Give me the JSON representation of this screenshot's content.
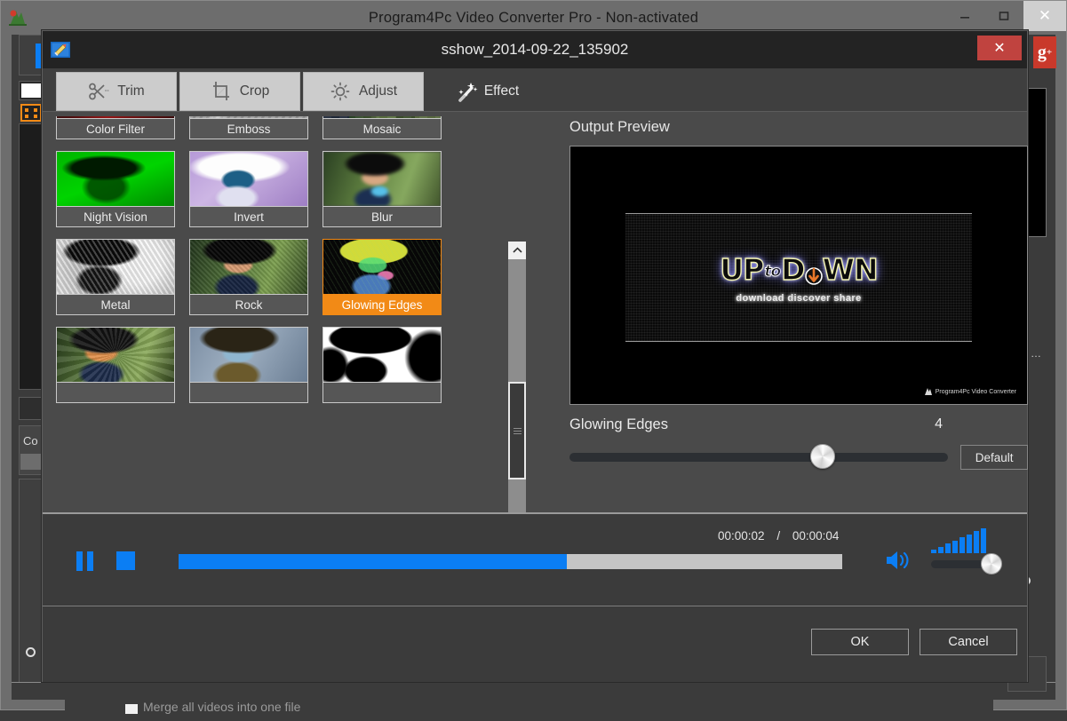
{
  "app_window": {
    "title": "Program4Pc Video Converter Pro - Non-activated",
    "icon": "app-logo-icon",
    "controls": {
      "minimize": "–",
      "maximize": "□",
      "close": "✕"
    },
    "background": {
      "merge_checkbox_label": "Merge all videos into one file",
      "convert_label": "Co",
      "gplus_label": "g",
      "gplus_sup": "+"
    }
  },
  "dialog": {
    "title": "sshow_2014-09-22_135902",
    "icon": "edit-video-icon",
    "close_label": "✕",
    "tabs": [
      {
        "label": "Trim",
        "icon": "scissors-icon",
        "active": false
      },
      {
        "label": "Crop",
        "icon": "crop-icon",
        "active": false
      },
      {
        "label": "Adjust",
        "icon": "brightness-icon",
        "active": false
      },
      {
        "label": "Effect",
        "icon": "magic-wand-icon",
        "active": true
      }
    ],
    "effects": [
      {
        "label": "Color Filter",
        "selected": false,
        "style": "colorfilter"
      },
      {
        "label": "Emboss",
        "selected": false,
        "style": "emboss"
      },
      {
        "label": "Mosaic",
        "selected": false,
        "style": "mosaic"
      },
      {
        "label": "Night Vision",
        "selected": false,
        "style": "nightvision"
      },
      {
        "label": "Invert",
        "selected": false,
        "style": "invert"
      },
      {
        "label": "Blur",
        "selected": false,
        "style": "blur"
      },
      {
        "label": "Metal",
        "selected": false,
        "style": "metal"
      },
      {
        "label": "Rock",
        "selected": false,
        "style": "rock"
      },
      {
        "label": "Glowing Edges",
        "selected": true,
        "style": "glowing"
      },
      {
        "label": "",
        "selected": false,
        "style": "oil"
      },
      {
        "label": "",
        "selected": false,
        "style": "cool"
      },
      {
        "label": "",
        "selected": false,
        "style": "threshold"
      }
    ],
    "scrollbar": {
      "up_glyph": "⌃",
      "down_glyph": "⌄"
    },
    "preview": {
      "heading": "Output Preview",
      "logo_part1": "UP",
      "logo_part2": "to",
      "logo_part3": "D",
      "logo_part4": "WN",
      "tagline": "download discover share",
      "watermark": "Program4Pc Video Converter"
    },
    "slider": {
      "name": "Glowing Edges",
      "value": "4",
      "default_label": "Default",
      "position_percent": 63
    },
    "player": {
      "pause_icon": "pause-icon",
      "stop_icon": "stop-icon",
      "current_time": "00:00:02",
      "separator": "/",
      "total_time": "00:00:04",
      "progress_percent": 58.5,
      "speaker_icon": "speaker-icon",
      "volume_percent": 78
    },
    "footer": {
      "ok_label": "OK",
      "cancel_label": "Cancel"
    }
  },
  "colors": {
    "accent_orange": "#f28a16",
    "accent_blue": "#0b7ef4",
    "dialog_bg": "#3f3f3f",
    "content_bg": "#4a4a4a",
    "titlebar_bg": "#232323",
    "close_red": "#c0433f",
    "gplus_red": "#c9392b"
  }
}
